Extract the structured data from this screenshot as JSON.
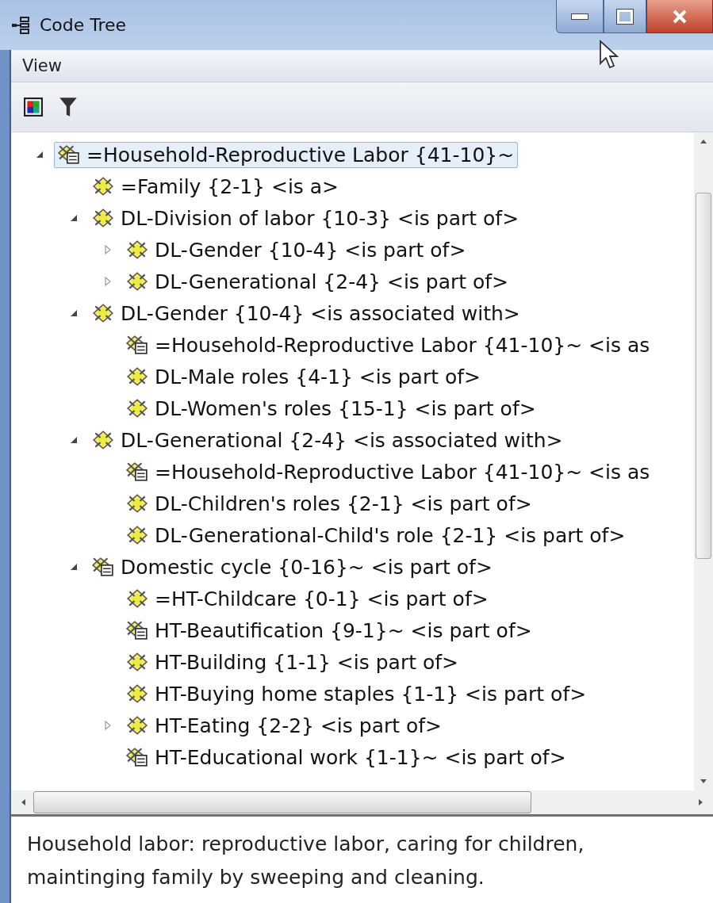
{
  "window": {
    "title": "Code Tree"
  },
  "menu": [
    "View"
  ],
  "tree": [
    {
      "label": "=Household-Reproductive Labor {41-10}~",
      "kind": "memo",
      "selected": true,
      "expanded": true,
      "children": [
        {
          "label": "=Family {2-1} <is a>",
          "kind": "code",
          "selected": false
        },
        {
          "label": "DL-Division of labor {10-3} <is part of>",
          "kind": "code",
          "selected": false,
          "expanded": true,
          "children": [
            {
              "label": "DL-Gender {10-4} <is part of>",
              "kind": "code",
              "selected": false,
              "expanded": false
            },
            {
              "label": "DL-Generational {2-4} <is part of>",
              "kind": "code",
              "selected": false,
              "expanded": false
            }
          ]
        },
        {
          "label": "DL-Gender {10-4} <is associated with>",
          "kind": "code",
          "selected": false,
          "expanded": true,
          "children": [
            {
              "label": "=Household-Reproductive Labor {41-10}~ <is as",
              "kind": "memo",
              "selected": false
            },
            {
              "label": "DL-Male roles {4-1} <is part of>",
              "kind": "code",
              "selected": false
            },
            {
              "label": "DL-Women's roles {15-1} <is part of>",
              "kind": "code",
              "selected": false
            }
          ]
        },
        {
          "label": "DL-Generational {2-4} <is associated with>",
          "kind": "code",
          "selected": false,
          "expanded": true,
          "children": [
            {
              "label": "=Household-Reproductive Labor {41-10}~ <is as",
              "kind": "memo",
              "selected": false
            },
            {
              "label": "DL-Children's roles {2-1} <is part of>",
              "kind": "code",
              "selected": false
            },
            {
              "label": "DL-Generational-Child's role {2-1} <is part of>",
              "kind": "code",
              "selected": false
            }
          ]
        },
        {
          "label": "Domestic cycle {0-16}~ <is part of>",
          "kind": "memo",
          "selected": false,
          "expanded": true,
          "children": [
            {
              "label": "=HT-Childcare {0-1} <is part of>",
              "kind": "code",
              "selected": false
            },
            {
              "label": "HT-Beautification {9-1}~ <is part of>",
              "kind": "memo",
              "selected": false
            },
            {
              "label": "HT-Building {1-1} <is part of>",
              "kind": "code",
              "selected": false
            },
            {
              "label": "HT-Buying home staples {1-1} <is part of>",
              "kind": "code",
              "selected": false
            },
            {
              "label": "HT-Eating {2-2} <is part of>",
              "kind": "code",
              "selected": false,
              "expanded": false
            },
            {
              "label": "HT-Educational work {1-1}~ <is part of>",
              "kind": "memo",
              "selected": false
            }
          ]
        }
      ]
    }
  ],
  "description": "Household labor: reproductive labor, caring for children, maintinging family by sweeping and cleaning."
}
